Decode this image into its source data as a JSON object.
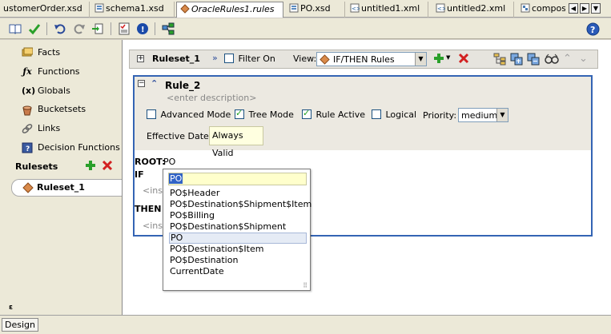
{
  "tabs": [
    {
      "label": "ustomerOrder.xsd",
      "active": false
    },
    {
      "label": "schema1.xsd",
      "active": false
    },
    {
      "label": "OracleRules1.rules",
      "active": true
    },
    {
      "label": "PO.xsd",
      "active": false
    },
    {
      "label": "untitled1.xml",
      "active": false
    },
    {
      "label": "untitled2.xml",
      "active": false
    },
    {
      "label": "composit",
      "active": false
    }
  ],
  "sidebar": {
    "items": [
      {
        "label": "Facts",
        "icon": "facts-icon"
      },
      {
        "label": "Functions",
        "icon": "function-icon"
      },
      {
        "label": "Globals",
        "icon": "globals-icon"
      },
      {
        "label": "Bucketsets",
        "icon": "bucketsets-icon"
      },
      {
        "label": "Links",
        "icon": "links-icon"
      },
      {
        "label": "Decision Functions",
        "icon": "decision-functions-icon"
      }
    ],
    "rulesets_heading": "Rulesets",
    "ruleset_item": "Ruleset_1"
  },
  "ruleset_header": {
    "title": "Ruleset_1",
    "filter_label": "Filter On",
    "view_label": "View:",
    "view_value": "IF/THEN Rules"
  },
  "rule": {
    "name": "Rule_2",
    "description_placeholder": "<enter description>",
    "advanced_mode_label": "Advanced Mode",
    "tree_mode_label": "Tree Mode",
    "rule_active_label": "Rule Active",
    "logical_label": "Logical",
    "priority_label": "Priority:",
    "priority_value": "medium",
    "effective_date_label": "Effective Date:",
    "effective_date_value": "Always Valid",
    "root_label": "ROOT:",
    "root_value": "PO",
    "if_label": "IF",
    "then_label": "THEN",
    "insert_placeholder_if": "<inse",
    "insert_placeholder_then": "<inse"
  },
  "popup": {
    "input_value": "PO",
    "options": [
      "PO$Header",
      "PO$Destination$Shipment$Item",
      "PO$Billing",
      "PO$Destination$Shipment",
      "PO",
      "PO$Destination$Item",
      "PO$Destination",
      "CurrentDate"
    ],
    "selected_index": 4
  },
  "bottom": {
    "design_tab": "Design"
  },
  "colors": {
    "rule_border": "#3464b4",
    "add_green": "#2aa02a",
    "delete_red": "#d22020"
  }
}
